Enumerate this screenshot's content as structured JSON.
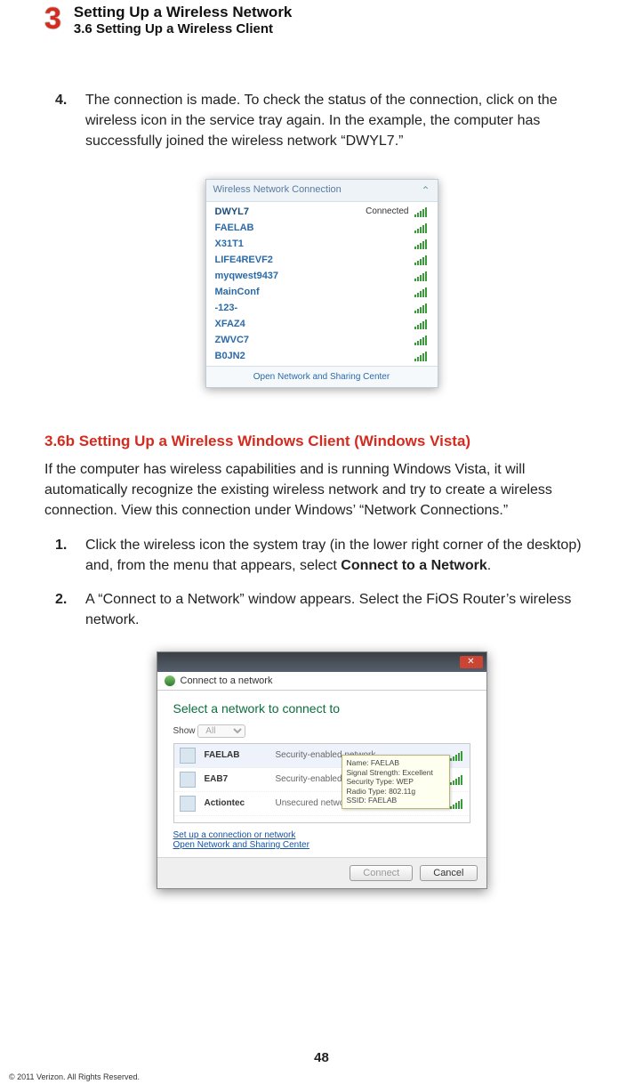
{
  "header": {
    "chapter_number": "3",
    "title": "Setting Up a Wireless Network",
    "subtitle": "3.6  Setting Up a Wireless Client"
  },
  "step4": {
    "num": "4.",
    "text": "The connection is made. To check the status of the connection, click on the wireless icon in the service tray again. In the example, the computer has successfully joined the wireless network “DWYL7.”"
  },
  "fig1": {
    "header": "Wireless Network Connection",
    "footer": "Open Network and Sharing Center",
    "connected_label": "Connected",
    "rows": [
      {
        "name": "DWYL7",
        "status": "Connected"
      },
      {
        "name": "FAELAB"
      },
      {
        "name": "X31T1"
      },
      {
        "name": "LIFE4REVF2"
      },
      {
        "name": "myqwest9437"
      },
      {
        "name": "MainConf"
      },
      {
        "name": "-123-"
      },
      {
        "name": "XFAZ4"
      },
      {
        "name": "ZWVC7"
      },
      {
        "name": "B0JN2"
      }
    ]
  },
  "section": {
    "heading": "3.6b  Setting Up a Wireless Windows Client (Windows Vista)",
    "intro": "If the computer has wireless capabilities and is running Windows Vista, it will automatically recognize the existing wireless network and try to create a wireless connection. View this connection under Windows’ “Network Connections.”",
    "step1": {
      "num": "1.",
      "pre": "Click the wireless icon the system tray (in the lower right corner of the desktop) and, from the menu that appears, select ",
      "bold": "Connect to a Network",
      "post": "."
    },
    "step2": {
      "num": "2.",
      "text": "A “Connect to a Network” window appears. Select the FiOS Router’s wireless network."
    }
  },
  "fig2": {
    "crumb": "Connect to a network",
    "heading": "Select a network to connect to",
    "show_label": "Show",
    "show_value": "All",
    "rows": [
      {
        "name": "FAELAB",
        "type": "Security-enabled network"
      },
      {
        "name": "EAB7",
        "type": "Security-enabled network"
      },
      {
        "name": "Actiontec",
        "type": "Unsecured network"
      }
    ],
    "tooltip": {
      "l1": "Name: FAELAB",
      "l2": "Signal Strength: Excellent",
      "l3": "Security Type: WEP",
      "l4": "Radio Type: 802.11g",
      "l5": "SSID: FAELAB"
    },
    "link1": "Set up a connection or network",
    "link2": "Open Network and Sharing Center",
    "btn_connect": "Connect",
    "btn_cancel": "Cancel"
  },
  "footer": {
    "page": "48",
    "copy": "© 2011 Verizon. All Rights Reserved."
  }
}
